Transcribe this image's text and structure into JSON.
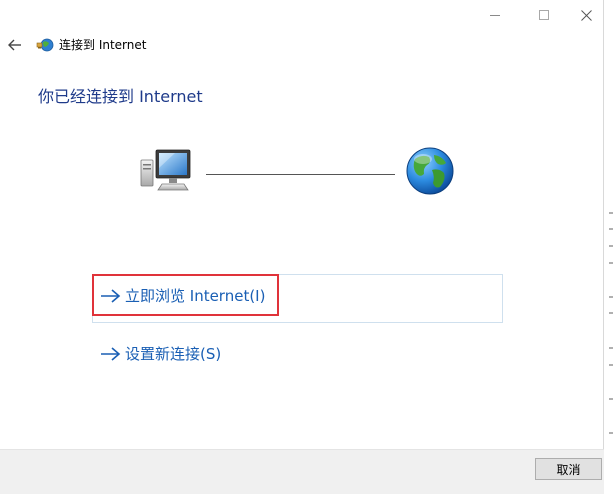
{
  "window": {
    "title": "连接到 Internet",
    "controls": {
      "minimize_icon": "minimize-icon",
      "maximize_icon": "maximize-icon",
      "close_icon": "close-icon"
    }
  },
  "main": {
    "heading": "你已经连接到 Internet",
    "diagram": {
      "left_icon": "computer-icon",
      "right_icon": "globe-icon"
    },
    "options": [
      {
        "label": "立即浏览 Internet(I)",
        "icon": "arrow-right-icon",
        "highlighted": true
      },
      {
        "label": "设置新连接(S)",
        "icon": "arrow-right-icon",
        "highlighted": false
      }
    ]
  },
  "footer": {
    "cancel_label": "取消"
  },
  "colors": {
    "heading": "#1e3a8a",
    "link": "#1a5fb4",
    "highlight_border": "#e0333a",
    "footer_bg": "#f0f0f0"
  }
}
